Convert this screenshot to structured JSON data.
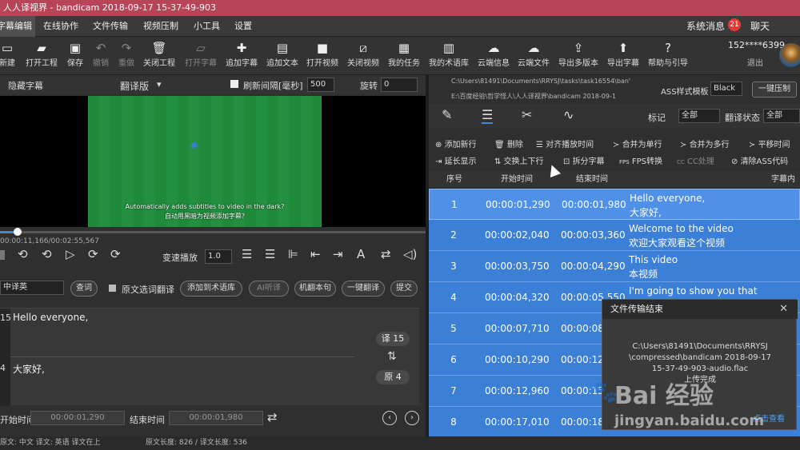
{
  "window": {
    "title": "人人译视界 - bandicam 2018-09-17 15-37-49-903"
  },
  "menu": {
    "items": [
      "字幕编辑",
      "在线协作",
      "文件传输",
      "视频压制",
      "小工具",
      "设置"
    ],
    "right": {
      "messages": "系统消息",
      "message_count": "21",
      "chat": "聊天"
    }
  },
  "toolbar": {
    "items": [
      {
        "label": "新建",
        "icon": "new-file-icon"
      },
      {
        "label": "打开工程",
        "icon": "folder-open-icon"
      },
      {
        "label": "保存",
        "icon": "save-icon"
      },
      {
        "label": "撤销",
        "icon": "undo-icon"
      },
      {
        "label": "重做",
        "icon": "redo-icon"
      },
      {
        "label": "关闭工程",
        "icon": "trash-icon"
      },
      {
        "label": "打开字幕",
        "icon": "folder-icon"
      },
      {
        "label": "追加字幕",
        "icon": "plus-icon"
      },
      {
        "label": "追加文本",
        "icon": "add-text-icon"
      },
      {
        "label": "打开视频",
        "icon": "video-camera-icon"
      },
      {
        "label": "关闭视频",
        "icon": "video-off-icon"
      },
      {
        "label": "我的任务",
        "icon": "clipboard-icon"
      },
      {
        "label": "我的术语库",
        "icon": "glossary-icon"
      },
      {
        "label": "云端信息",
        "icon": "cloud-icon"
      },
      {
        "label": "云端文件",
        "icon": "cloud-upload-icon"
      },
      {
        "label": "导出多版本",
        "icon": "export-multi-icon"
      },
      {
        "label": "导出字幕",
        "icon": "export-icon"
      },
      {
        "label": "帮助与引导",
        "icon": "help-icon"
      }
    ],
    "user": "152****6399",
    "logout": "退出"
  },
  "player": {
    "hide_subtitles": "隐藏字幕",
    "version": "翻译版",
    "refresh_label": "刷新间隔[毫秒]",
    "refresh_value": "500",
    "rotate_label": "旋转",
    "rotate_value": "0",
    "subtitle_en": "Automatically adds subtitles to video in the dark?",
    "subtitle_zh": "自动用黑暗为视频添加字幕?",
    "time": "00:00:11,166/00:02:55,567",
    "speed_label": "变速播放",
    "speed_value": "1.0"
  },
  "translate_bar": {
    "lang": "中译英",
    "lookup": "查词",
    "selection_translate": "原文选词翻译",
    "add_term": "添加到术语库",
    "ai_listen": "AI听译",
    "machine": "机翻本句",
    "one_click": "一键翻译",
    "submit": "提交"
  },
  "editor": {
    "trans_num": "15",
    "trans_text": "Hello everyone,",
    "orig_num": "4",
    "orig_text": "大家好,",
    "trans_pill": "译 15",
    "orig_pill": "原 4",
    "start_label": "开始时间",
    "start_value": "00:00:01,290",
    "end_label": "结束时间",
    "end_value": "00:00:01,980"
  },
  "status_bar": {
    "left": "原文: 中文 译文: 英语 译文在上",
    "right": "原文长度: 826 / 译文长度: 536"
  },
  "right_panel": {
    "path1": "C:\\Users\\81491\\Documents\\RRYSJ\\tasks\\task16554\\ban'",
    "path2": "E:\\百度经验\\哲学怪人\\人人译视界\\bandicam 2018-09-1",
    "ass_label": "ASS样式模板",
    "ass_value": "Black",
    "compress": "一键压制",
    "mark_label": "标记",
    "mark_value": "全部",
    "trans_state": "翻译状态",
    "trans_state_value": "全部",
    "actions_row1": [
      "添加新行",
      "删除",
      "对齐播放时间",
      "合并为单行",
      "合并为多行",
      "平移时间"
    ],
    "actions_row2": [
      "延长显示",
      "交换上下行",
      "拆分字幕",
      "FPS转换",
      "CC处理",
      "清除ASS代码"
    ],
    "columns": [
      "序号",
      "开始时间",
      "结束时间",
      "字幕内容"
    ],
    "rows": [
      {
        "seq": "1",
        "start": "00:00:01,290",
        "end": "00:00:01,980",
        "line1": "Hello everyone,",
        "line2": "大家好,"
      },
      {
        "seq": "2",
        "start": "00:00:02,040",
        "end": "00:00:03,360",
        "line1": "Welcome to the video",
        "line2": "欢迎大家观看这个视频"
      },
      {
        "seq": "3",
        "start": "00:00:03,750",
        "end": "00:00:04,290",
        "line1": "This video",
        "line2": "本视频"
      },
      {
        "seq": "4",
        "start": "00:00:04,320",
        "end": "00:00:05,550",
        "line1": "I'm going to show you that",
        "line2": ""
      },
      {
        "seq": "5",
        "start": "00:00:07,710",
        "end": "00:00:08",
        "line1": "",
        "line2": ""
      },
      {
        "seq": "6",
        "start": "00:00:10,290",
        "end": "00:00:12",
        "line1": "",
        "line2": ""
      },
      {
        "seq": "7",
        "start": "00:00:12,960",
        "end": "00:00:15",
        "line1": "",
        "line2": ""
      },
      {
        "seq": "8",
        "start": "00:00:17,010",
        "end": "00:00:18",
        "line1": "",
        "line2": ""
      }
    ]
  },
  "popup": {
    "title": "文件传输结束",
    "body1": "C:\\Users\\81491\\Documents\\RRYSJ",
    "body2": "\\compressed\\bandicam 2018-09-17",
    "body3": "15-37-49-903-audio.flac",
    "body4": "上传完成",
    "link": "点击查看"
  },
  "watermark": {
    "main": "Bai 经验",
    "sub": "jingyan.baidu.com"
  }
}
